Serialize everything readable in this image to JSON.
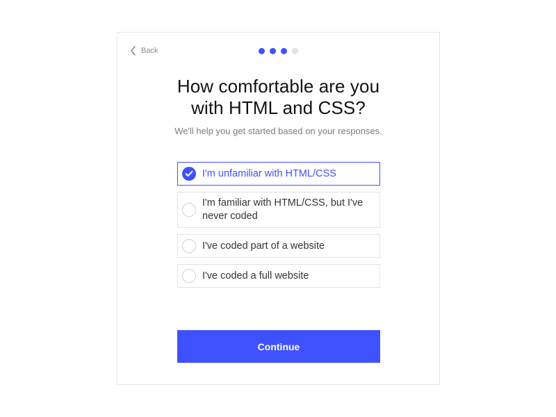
{
  "colors": {
    "accent": "#3f51ff",
    "dot_active": "#3f51ff",
    "dot_inactive": "#e2e2e2"
  },
  "nav": {
    "back_label": "Back",
    "back_icon": "chevron-left-icon"
  },
  "progress": {
    "total_steps": 4,
    "current_step": 3
  },
  "heading": {
    "title_line1": "How comfortable are you",
    "title_line2": "with HTML and CSS?",
    "subtitle": "We'll help you get started based on your responses."
  },
  "options": [
    {
      "label": "I'm unfamiliar with HTML/CSS",
      "selected": true
    },
    {
      "label": "I'm familiar with HTML/CSS, but I've never coded",
      "selected": false
    },
    {
      "label": "I've coded part of a website",
      "selected": false
    },
    {
      "label": "I've coded a full website",
      "selected": false
    }
  ],
  "actions": {
    "continue_label": "Continue"
  }
}
